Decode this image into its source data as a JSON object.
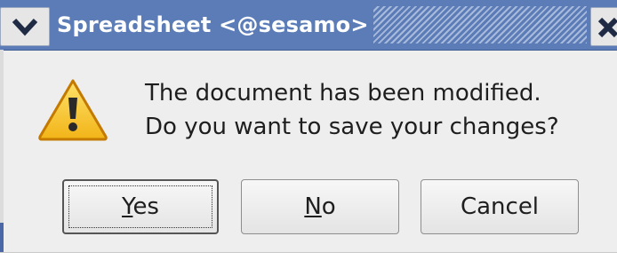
{
  "window": {
    "title": "Spreadsheet <@sesamo>"
  },
  "icons": {
    "menu": "chevron-down-icon",
    "close": "close-icon",
    "message": "warning-icon"
  },
  "dialog": {
    "message_line1": "The document has been modified.",
    "message_line2": "Do you want to save your changes?"
  },
  "buttons": {
    "yes": {
      "mnemonic": "Y",
      "rest": "es"
    },
    "no": {
      "mnemonic": "N",
      "rest": "o"
    },
    "cancel": {
      "label": "Cancel"
    }
  },
  "colors": {
    "titlebar": "#5b7cb7",
    "dialog_bg": "#eeeeee",
    "warning_fill": "#f5c518"
  }
}
